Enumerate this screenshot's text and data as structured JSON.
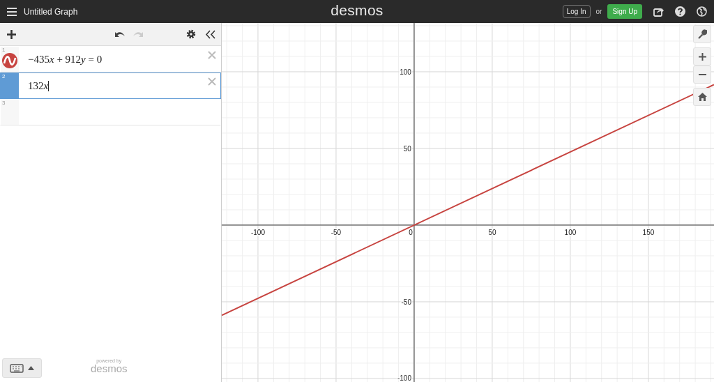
{
  "header": {
    "title": "Untitled Graph",
    "brand": "desmos",
    "login": "Log In",
    "or": "or",
    "signup": "Sign Up"
  },
  "expressions": [
    {
      "number": "1",
      "text": "−435x + 912y = 0",
      "selected": false,
      "color": "#c74440",
      "cursor": false
    },
    {
      "number": "2",
      "text": "132x",
      "selected": true,
      "cursor": true
    },
    {
      "number": "3",
      "selected": false
    }
  ],
  "footer": {
    "powered_by": "powered by",
    "brand": "desmos"
  },
  "graph": {
    "chart_data": {
      "type": "line",
      "grid": true,
      "x": [
        -123.2,
        192
      ],
      "series": [
        {
          "color": "#c74440",
          "values": [
            -58.8,
            91.6
          ]
        }
      ],
      "xlim": [
        -123.2,
        192
      ],
      "ylim": [
        -102.3,
        131.8
      ],
      "xticks": [
        -100,
        -50,
        0,
        50,
        100,
        150
      ],
      "yticks": [
        -100,
        -50,
        50,
        100
      ]
    }
  }
}
